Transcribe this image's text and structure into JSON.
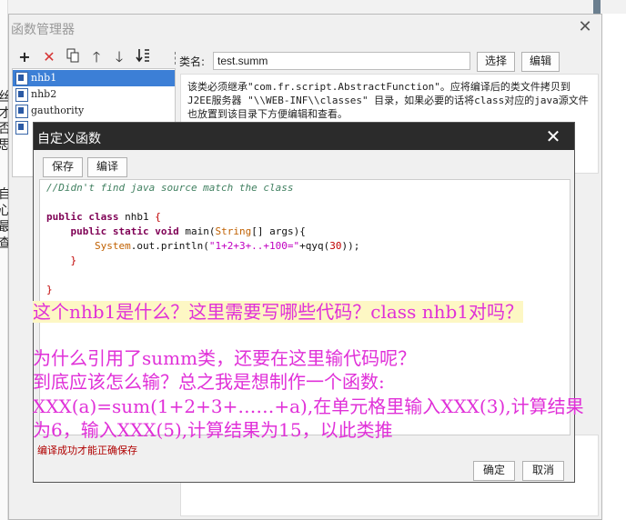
{
  "outer_dialog": {
    "title": "函数管理器",
    "toolbar": {
      "add_icon": "plus-icon",
      "delete_icon": "x-icon",
      "copy_icon": "copy-icon",
      "up_icon": "arrow-up-icon",
      "down_icon": "arrow-down-icon",
      "sort_icon": "sort-icon"
    },
    "function_list": [
      {
        "name": "nhb1",
        "selected": true
      },
      {
        "name": "nhb2",
        "selected": false
      },
      {
        "name": "gauthority",
        "selected": false
      },
      {
        "name": "",
        "selected": false
      }
    ],
    "class_label": "类名:",
    "class_value": "test.summ",
    "select_label": "选择",
    "edit_label": "编辑",
    "description": "该类必须继承\"com.fr.script.AbstractFunction\"。应将编译后的类文件拷贝到J2EE服务器 \"\\\\WEB-INF\\\\classes\" 目录，如果必要的话将class对应的java源文件也放置到该目录下方便编辑和查看。"
  },
  "inner_dialog": {
    "title": "自定义函数",
    "save_label": "保存",
    "compile_label": "编译",
    "code": {
      "comment": "//Didn't find java source match the class",
      "kw_public": "public",
      "kw_class": "class",
      "class_name": "nhb1",
      "open_brace": "{",
      "kw_static": "static",
      "kw_void": "void",
      "method_sig_start": "main(",
      "string_type": "String",
      "method_sig_end": "[] args){",
      "system": "System",
      "out_println": ".out.println(",
      "string_literal": "\"1+2+3+..+100=\"",
      "plus_call": "+qyq(",
      "number": "30",
      "call_end": "));",
      "close_brace": "}"
    },
    "status": "编译成功才能正确保存",
    "ok_label": "确定",
    "cancel_label": "取消"
  },
  "overlay": {
    "line1": "这个nhb1是什么？这里需要写哪些代码？class nhb1对吗？",
    "line2": "为什么引用了summ类，还要在这里输代码呢？",
    "line3": "到底应该怎么输？总之我是想制作一个函数:",
    "line4": "XXX(a)=sum(1+2+3+……+a),在单元格里输入XXX(3),计算结果",
    "line5": "为6，输入XXX(5),计算结果为15，以此类推"
  },
  "background": {
    "left_chars": [
      "丝",
      "才",
      "否",
      "思",
      "自",
      "心",
      "最",
      "查"
    ]
  },
  "colors": {
    "selection": "#3c7fd6",
    "inner_titlebar": "#2b2b2b",
    "overlay_text": "#e030d8",
    "status_text": "#b00000"
  }
}
